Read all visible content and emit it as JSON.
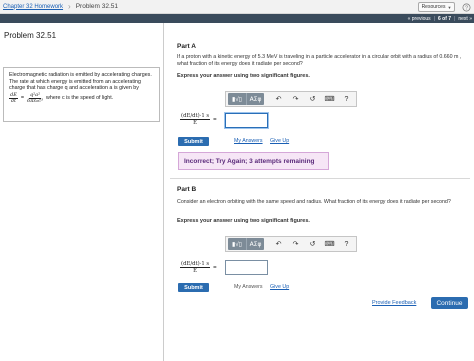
{
  "header": {
    "breadcrumb_link": "Chapter 32 Homework",
    "breadcrumb_current": "Problem 32.51",
    "resources_label": "Resources",
    "help_glyph": "?"
  },
  "nav": {
    "previous": "« previous",
    "sep1": "|",
    "position": "6 of 7",
    "sep2": "|",
    "next": "next »"
  },
  "problem": {
    "title": "Problem 32.51",
    "info_text": "Electromagnetic radiation is emitted by accelerating charges. The rate at which energy is emitted from an accelerating charge that has charge q and acceleration a is given by",
    "formula_lhs_num": "dE",
    "formula_lhs_den": "dt",
    "formula_eq": "=",
    "formula_rhs_num": "q²a²",
    "formula_rhs_den": "6πε₀c³",
    "formula_tail": "where c is the speed of light."
  },
  "partA": {
    "label": "Part A",
    "question": "If a proton with a kinetic energy of 5.3 MeV is traveling in a particle accelerator in a circular orbit with a radius of 0.660 m , what fraction of its energy does it radiate per second?",
    "instruction": "Express your answer using two significant figures.",
    "answer_num": "(dE/dt)·1 s",
    "answer_den": "E",
    "answer_eq": "=",
    "answer_value": "",
    "submit_label": "Submit",
    "my_answers_label": "My Answers",
    "give_up_label": "Give Up",
    "feedback": "Incorrect; Try Again; 3 attempts remaining"
  },
  "partB": {
    "label": "Part B",
    "question": "Consider an electron orbiting with the same speed and radius. What fraction of its energy does it radiate per second?",
    "instruction": "Express your answer using two significant figures.",
    "answer_num": "(dE/dt)·1 s",
    "answer_den": "E",
    "answer_eq": "=",
    "answer_value": "",
    "submit_label": "Submit",
    "my_answers_label": "My Answers",
    "give_up_label": "Give Up"
  },
  "toolbar": {
    "templates_glyph": "▮√▯",
    "symbols_glyph": "ΑΣφ",
    "undo_glyph": "↶",
    "redo_glyph": "↷",
    "reset_glyph": "↺",
    "keyboard_glyph": "⌨",
    "help_glyph": "?"
  },
  "footer": {
    "provide_feedback": "Provide Feedback",
    "continue_label": "Continue"
  },
  "colors": {
    "nav_bar": "#3a4b5c",
    "accent_blue": "#2b6cb0",
    "feedback_bg": "#f6e6f6",
    "feedback_text": "#5a2a7a"
  }
}
